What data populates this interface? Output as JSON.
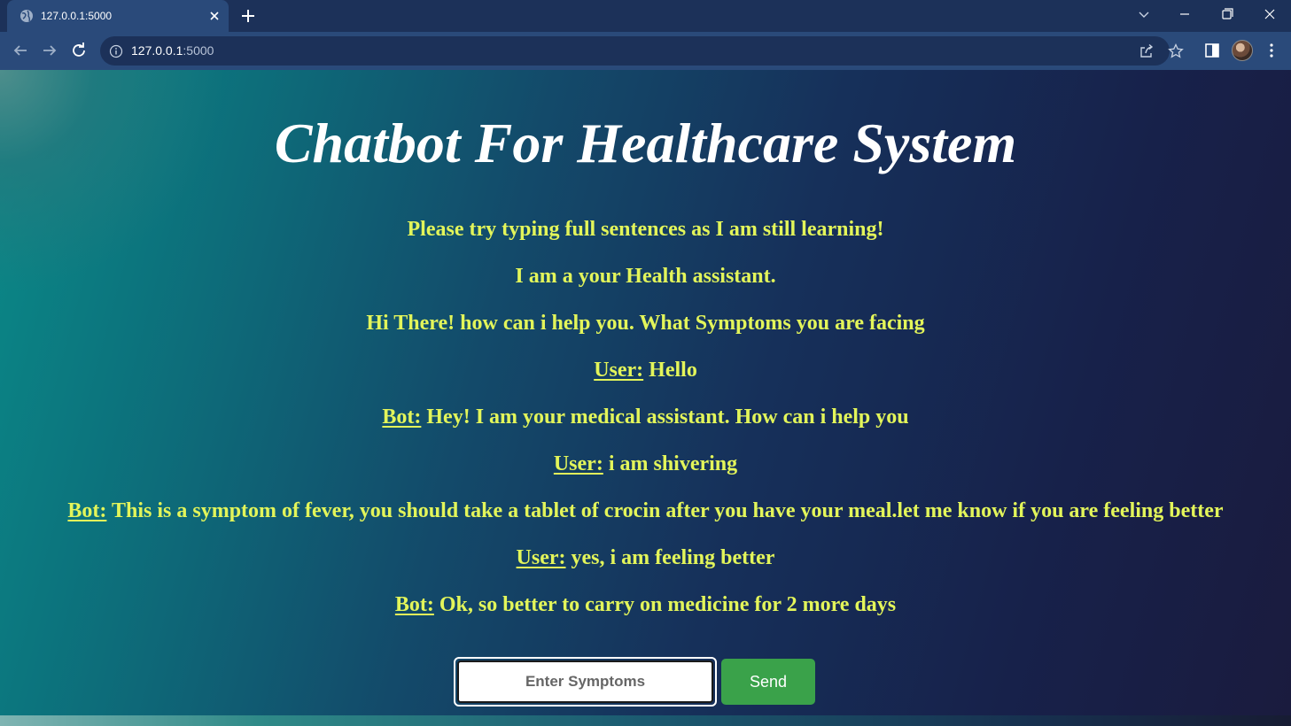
{
  "browser": {
    "tab": {
      "title": "127.0.0.1:5000",
      "favicon": "globe-icon"
    },
    "address": {
      "host": "127.0.0.1",
      "port": ":5000"
    }
  },
  "page": {
    "title": "Chatbot For Healthcare System",
    "lines": [
      {
        "speaker": "",
        "text": "Please try typing full sentences as I am still learning!"
      },
      {
        "speaker": "",
        "text": "I am a your Health assistant."
      },
      {
        "speaker": "",
        "text": "Hi There! how can i help you. What Symptoms you are facing"
      },
      {
        "speaker": "User:",
        "text": " Hello"
      },
      {
        "speaker": "Bot:",
        "text": " Hey! I am your medical assistant. How can i help you"
      },
      {
        "speaker": "User:",
        "text": " i am shivering"
      },
      {
        "speaker": "Bot:",
        "text": " This is a symptom of fever, you should take a tablet of crocin after you have your meal.let me know if you are feeling better"
      },
      {
        "speaker": "User:",
        "text": " yes, i am feeling better"
      },
      {
        "speaker": "Bot:",
        "text": " Ok, so better to carry on medicine for 2 more days"
      }
    ],
    "input": {
      "placeholder": "Enter Symptoms",
      "value": ""
    },
    "send_label": "Send"
  },
  "colors": {
    "chat_text": "#e3f55a",
    "title_text": "#ffffff",
    "send_button": "#3aa24a",
    "browser_frame": "#1c3159",
    "browser_toolbar": "#2a4a7a"
  }
}
